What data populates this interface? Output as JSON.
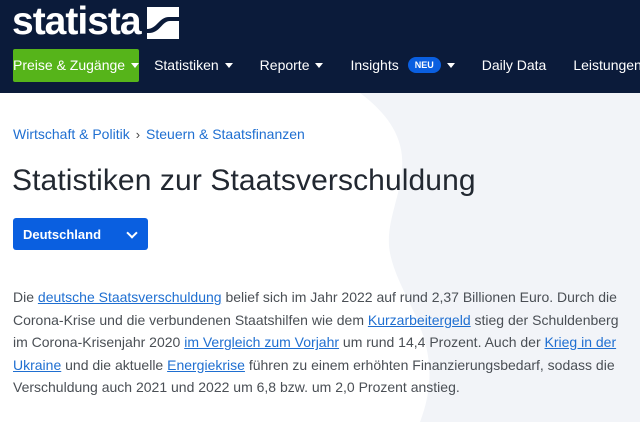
{
  "header": {
    "logo_text": "statista",
    "cta_label": "Preise & Zugänge",
    "nav": [
      {
        "label": "Statistiken"
      },
      {
        "label": "Reporte"
      },
      {
        "label": "Insights",
        "badge": "NEU"
      },
      {
        "label": "Daily Data"
      },
      {
        "label": "Leistungen"
      }
    ]
  },
  "breadcrumb": [
    "Wirtschaft & Politik",
    "Steuern & Staatsfinanzen"
  ],
  "breadcrumb_separator": "›",
  "page_title": "Statistiken zur Staatsverschuldung",
  "country_select": {
    "value": "Deutschland"
  },
  "intro": {
    "t1": "Die ",
    "l1": "deutsche Staatsverschuldung",
    "t2": " belief sich im Jahr 2022 auf rund 2,37 Billionen Euro. Durch die Corona-Krise und die verbundenen Staatshilfen wie dem ",
    "l2": "Kurzarbeitergeld",
    "t3": " stieg der Schuldenberg im Corona-Krisenjahr 2020 ",
    "l3": "im Vergleich zum Vorjahr",
    "t4": " um rund 14,4 Prozent. Auch der ",
    "l4": "Krieg in der Ukraine",
    "t5": " und die aktuelle ",
    "l5": "Energiekrise",
    "t6": " führen zu einem erhöhten Finanzierungsbedarf, sodass die Verschuldung auch 2021 und 2022 um 6,8 bzw. um 2,0 Prozent anstieg."
  },
  "colors": {
    "header_bg": "#0b1b3a",
    "cta_green": "#56b41a",
    "accent_blue": "#0a5fe0",
    "link_blue": "#1f6fd1"
  }
}
